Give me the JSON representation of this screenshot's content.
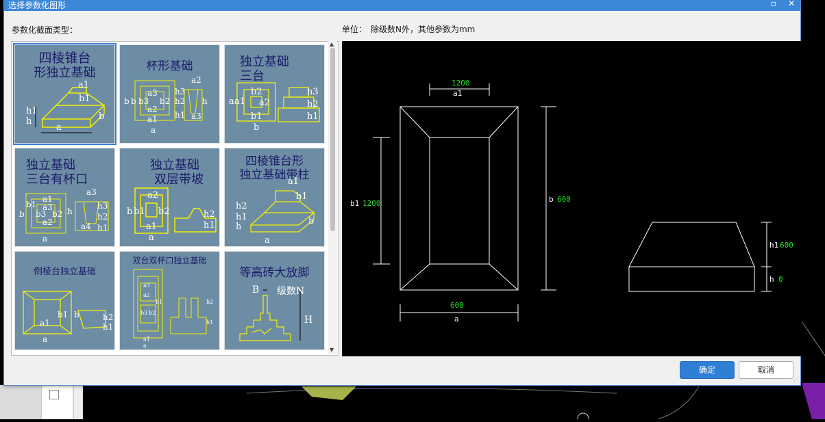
{
  "dialog": {
    "title": "选择参数化图形",
    "section_label": "参数化截面类型：",
    "unit_label": "单位：",
    "unit_value": "除级数N外，其他参数为mm",
    "ok_label": "确定",
    "cancel_label": "取消"
  },
  "thumbnails": [
    {
      "caption_1": "四棱锥台",
      "caption_2": "形独立基础",
      "labels": [
        "a1",
        "b1",
        "h1",
        "h",
        "a",
        "b"
      ]
    },
    {
      "caption_1": "杯形基础",
      "caption_2": "",
      "labels": [
        "a2",
        "a3",
        "b",
        "b",
        "b3",
        "b2",
        "a2",
        "a1",
        "h3",
        "h2",
        "h1",
        "h",
        "a3",
        "a"
      ]
    },
    {
      "caption_1": "独立基础",
      "caption_2": "三台",
      "labels": [
        "a",
        "a1",
        "b2",
        "a2",
        "b1",
        "b",
        "h3",
        "h2",
        "h1"
      ]
    },
    {
      "caption_1": "独立基础",
      "caption_2": "三台有杯口",
      "labels": [
        "a1",
        "a3",
        "a3",
        "a2",
        "b1",
        "b3",
        "b2",
        "b",
        "h",
        "a4",
        "h3",
        "h2",
        "h1",
        "a"
      ]
    },
    {
      "caption_1": "独立基础",
      "caption_2": "双层带坡",
      "labels": [
        "a2",
        "b1",
        "b2",
        "a1",
        "b",
        "a",
        "h2",
        "h1"
      ]
    },
    {
      "caption_1": "四棱锥台形",
      "caption_2": "独立基础带柱",
      "labels": [
        "a1",
        "b1",
        "h2",
        "h1",
        "h",
        "b",
        "a"
      ]
    },
    {
      "caption_1": "倒棱台独立基础",
      "caption_2": "",
      "labels": [
        "b1",
        "a1",
        "a",
        "b",
        "h2",
        "h1"
      ]
    },
    {
      "caption_1": "双台双杯口独立基础",
      "caption_2": "",
      "labels": [
        "a3",
        "a2",
        "b3",
        "b2",
        "b1",
        "h2",
        "h1",
        "a1",
        "a"
      ]
    },
    {
      "caption_1": "等高砖大放脚",
      "caption_2": "",
      "labels": [
        "B",
        "级数N",
        "H"
      ]
    }
  ],
  "preview": {
    "a1_value": "1200",
    "a1_label": "a1",
    "b1_value": "1200",
    "b1_label": "b1",
    "b_value": "600",
    "b_label": "b",
    "a_value": "600",
    "a_label": "a",
    "h1_value": "600",
    "h1_label": "h1",
    "h_value": "0",
    "h_label": "h"
  },
  "colors": {
    "titlebar": "#3c87d8",
    "thumb_bg": "#6d8da4",
    "thumb_line": "#f4f000",
    "cad_value": "#22e022",
    "cad_line": "#ffffff",
    "primary_button": "#2f7fd6"
  },
  "icons": [
    "maximize-icon",
    "close-icon",
    "scroll-up-icon",
    "scroll-down-icon",
    "resize-grip-icon"
  ]
}
